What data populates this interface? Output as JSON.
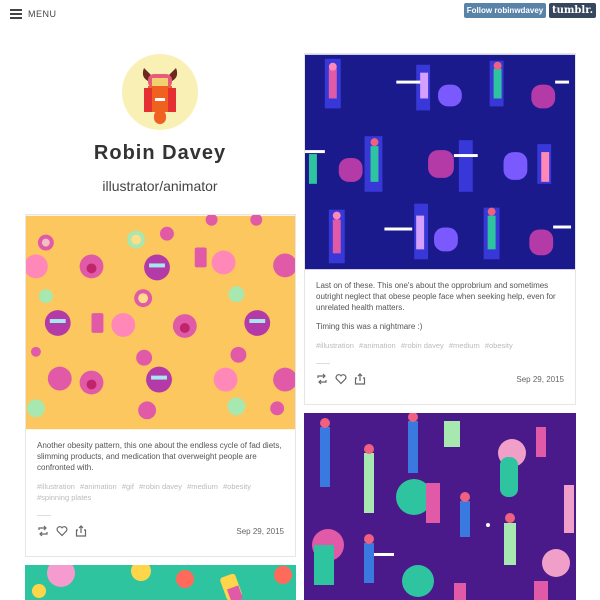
{
  "header": {
    "menu_label": "MENU",
    "follow_label": "Follow robinwdavey",
    "tumblr_label": "tumblr."
  },
  "profile": {
    "title": "Robin Davey",
    "description": "illustrator/animator"
  },
  "posts": [
    {
      "caption": [
        "Another obesity pattern, this one about the endless cycle of fad diets, slimming products, and medication that overweight people are confronted with."
      ],
      "tags": [
        "#illustration",
        "#animation",
        "#gif",
        "#robin davey",
        "#medium",
        "#obesity",
        "#spinning plates"
      ],
      "date": "Sep 29, 2015"
    },
    {
      "caption": [
        "Last on of these. This one's about the opprobrium and sometimes outright neglect that obese people face when seeking help, even for unrelated health matters.",
        "Timing this was a nightmare :)"
      ],
      "tags": [
        "#illustration",
        "#animation",
        "#robin davey",
        "#medium",
        "#obesity"
      ],
      "date": "Sep 29, 2015"
    }
  ],
  "colors": {
    "follow_bg": "#5a83a9",
    "tumblr_bg": "#36465d",
    "pattern_yellow": "#fcc75e",
    "pattern_navy": "#1a1a8c",
    "pattern_purple": "#4a1a8a",
    "pattern_teal": "#2ec4a0"
  },
  "icons": [
    "hamburger-icon",
    "reblog-icon",
    "heart-icon",
    "share-icon"
  ]
}
